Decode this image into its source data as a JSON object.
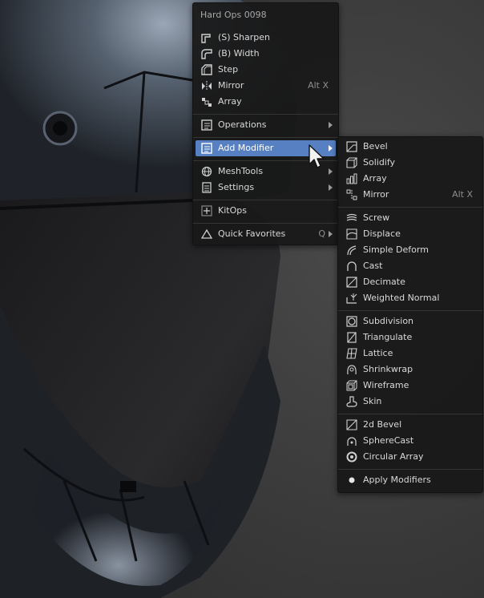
{
  "main_menu": {
    "title": "Hard Ops 0098",
    "items": [
      {
        "label": "(S) Sharpen",
        "icon": "sharpen-icon"
      },
      {
        "label": "(B) Width",
        "icon": "width-icon"
      },
      {
        "label": "Step",
        "icon": "step-icon"
      },
      {
        "label": "Mirror",
        "icon": "mirror-icon",
        "shortcut": "Alt X"
      },
      {
        "label": "Array",
        "icon": "array-icon"
      },
      {
        "label": "Operations",
        "icon": "operations-icon"
      },
      {
        "label": "Add Modifier",
        "icon": "add-modifier-icon"
      },
      {
        "label": "MeshTools",
        "icon": "meshtools-icon"
      },
      {
        "label": "Settings",
        "icon": "settings-icon"
      },
      {
        "label": "KitOps",
        "icon": "kitops-icon"
      },
      {
        "label": "Quick Favorites",
        "icon": "quick-favorites-icon",
        "shortcut": "Q"
      }
    ]
  },
  "sub_menu": {
    "items": [
      {
        "label": "Bevel",
        "icon": "bevel-icon"
      },
      {
        "label": "Solidify",
        "icon": "solidify-icon"
      },
      {
        "label": "Array",
        "icon": "array-icon"
      },
      {
        "label": "Mirror",
        "icon": "mirror-icon",
        "shortcut": "Alt X"
      },
      {
        "label": "Screw",
        "icon": "screw-icon"
      },
      {
        "label": "Displace",
        "icon": "displace-icon"
      },
      {
        "label": "Simple Deform",
        "icon": "simple-deform-icon"
      },
      {
        "label": "Cast",
        "icon": "cast-icon"
      },
      {
        "label": "Decimate",
        "icon": "decimate-icon"
      },
      {
        "label": "Weighted Normal",
        "icon": "weighted-normal-icon"
      },
      {
        "label": "Subdivision",
        "icon": "subdivision-icon"
      },
      {
        "label": "Triangulate",
        "icon": "triangulate-icon"
      },
      {
        "label": "Lattice",
        "icon": "lattice-icon"
      },
      {
        "label": "Shrinkwrap",
        "icon": "shrinkwrap-icon"
      },
      {
        "label": "Wireframe",
        "icon": "wireframe-icon"
      },
      {
        "label": "Skin",
        "icon": "skin-icon"
      },
      {
        "label": "2d Bevel",
        "icon": "2d-bevel-icon"
      },
      {
        "label": "SphereCast",
        "icon": "spherecast-icon"
      },
      {
        "label": "Circular Array",
        "icon": "circular-array-icon"
      },
      {
        "label": "Apply Modifiers",
        "icon": "apply-modifiers-icon"
      }
    ]
  },
  "colors": {
    "highlight": "#5680c2",
    "menu_bg": "#181818",
    "background": "#3c3c3c"
  }
}
